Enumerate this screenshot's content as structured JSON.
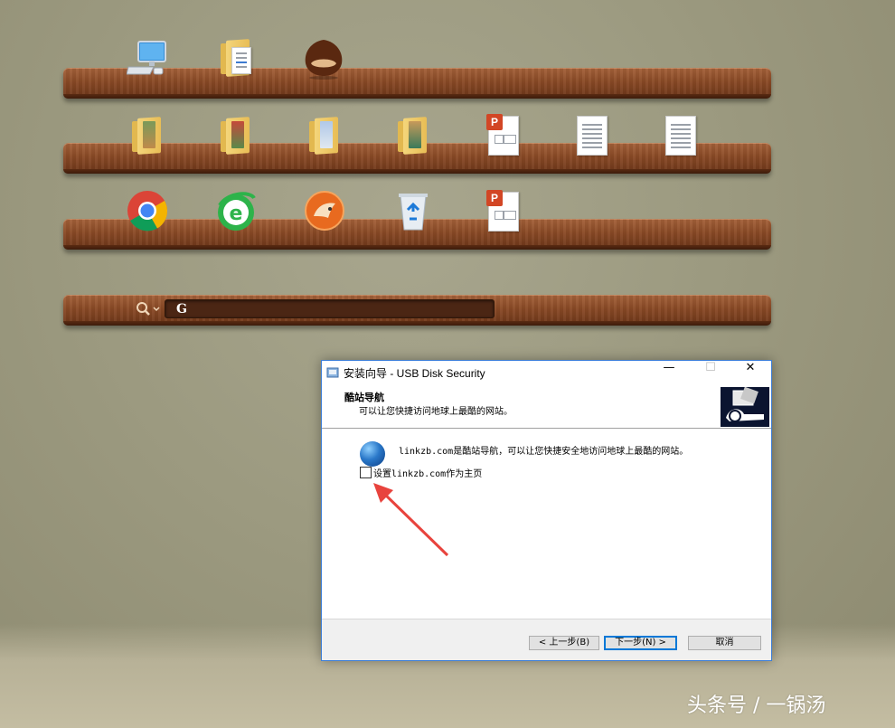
{
  "desktop": {
    "shelf1_icons": [
      "computer-icon",
      "document-folder-icon",
      "chestnut-icon"
    ],
    "shelf2_icons": [
      "picture-folder-icon",
      "picture-folder-icon",
      "picture-folder-icon",
      "picture-folder-icon",
      "ppt-file-icon",
      "text-file-icon",
      "text-file-icon"
    ],
    "shelf3_icons": [
      "chrome-icon",
      "ie360-icon",
      "cheetah-browser-icon",
      "recycle-bin-icon",
      "ppt-file-icon"
    ],
    "search_value": "G"
  },
  "dialog": {
    "title": "安装向导 - USB Disk Security",
    "header_title": "酷站导航",
    "header_subtitle": "可以让您快捷访问地球上最酷的网站。",
    "info_text": "linkzb.com是酷站导航，可以让您快捷安全地访问地球上最酷的网站。",
    "checkbox_label": "设置linkzb.com作为主页",
    "checkbox_checked": false,
    "buttons": {
      "back": "< 上一步(B)",
      "next": "下一步(N) >",
      "cancel": "取消"
    },
    "window_controls": {
      "minimize": "—",
      "maximize": "☐",
      "close": "✕"
    }
  },
  "watermark": "头条号 / 一锅汤",
  "colors": {
    "accent": "#0078d7",
    "annotation_arrow": "#e8433d",
    "shelf_wood": "#8a4a26"
  }
}
